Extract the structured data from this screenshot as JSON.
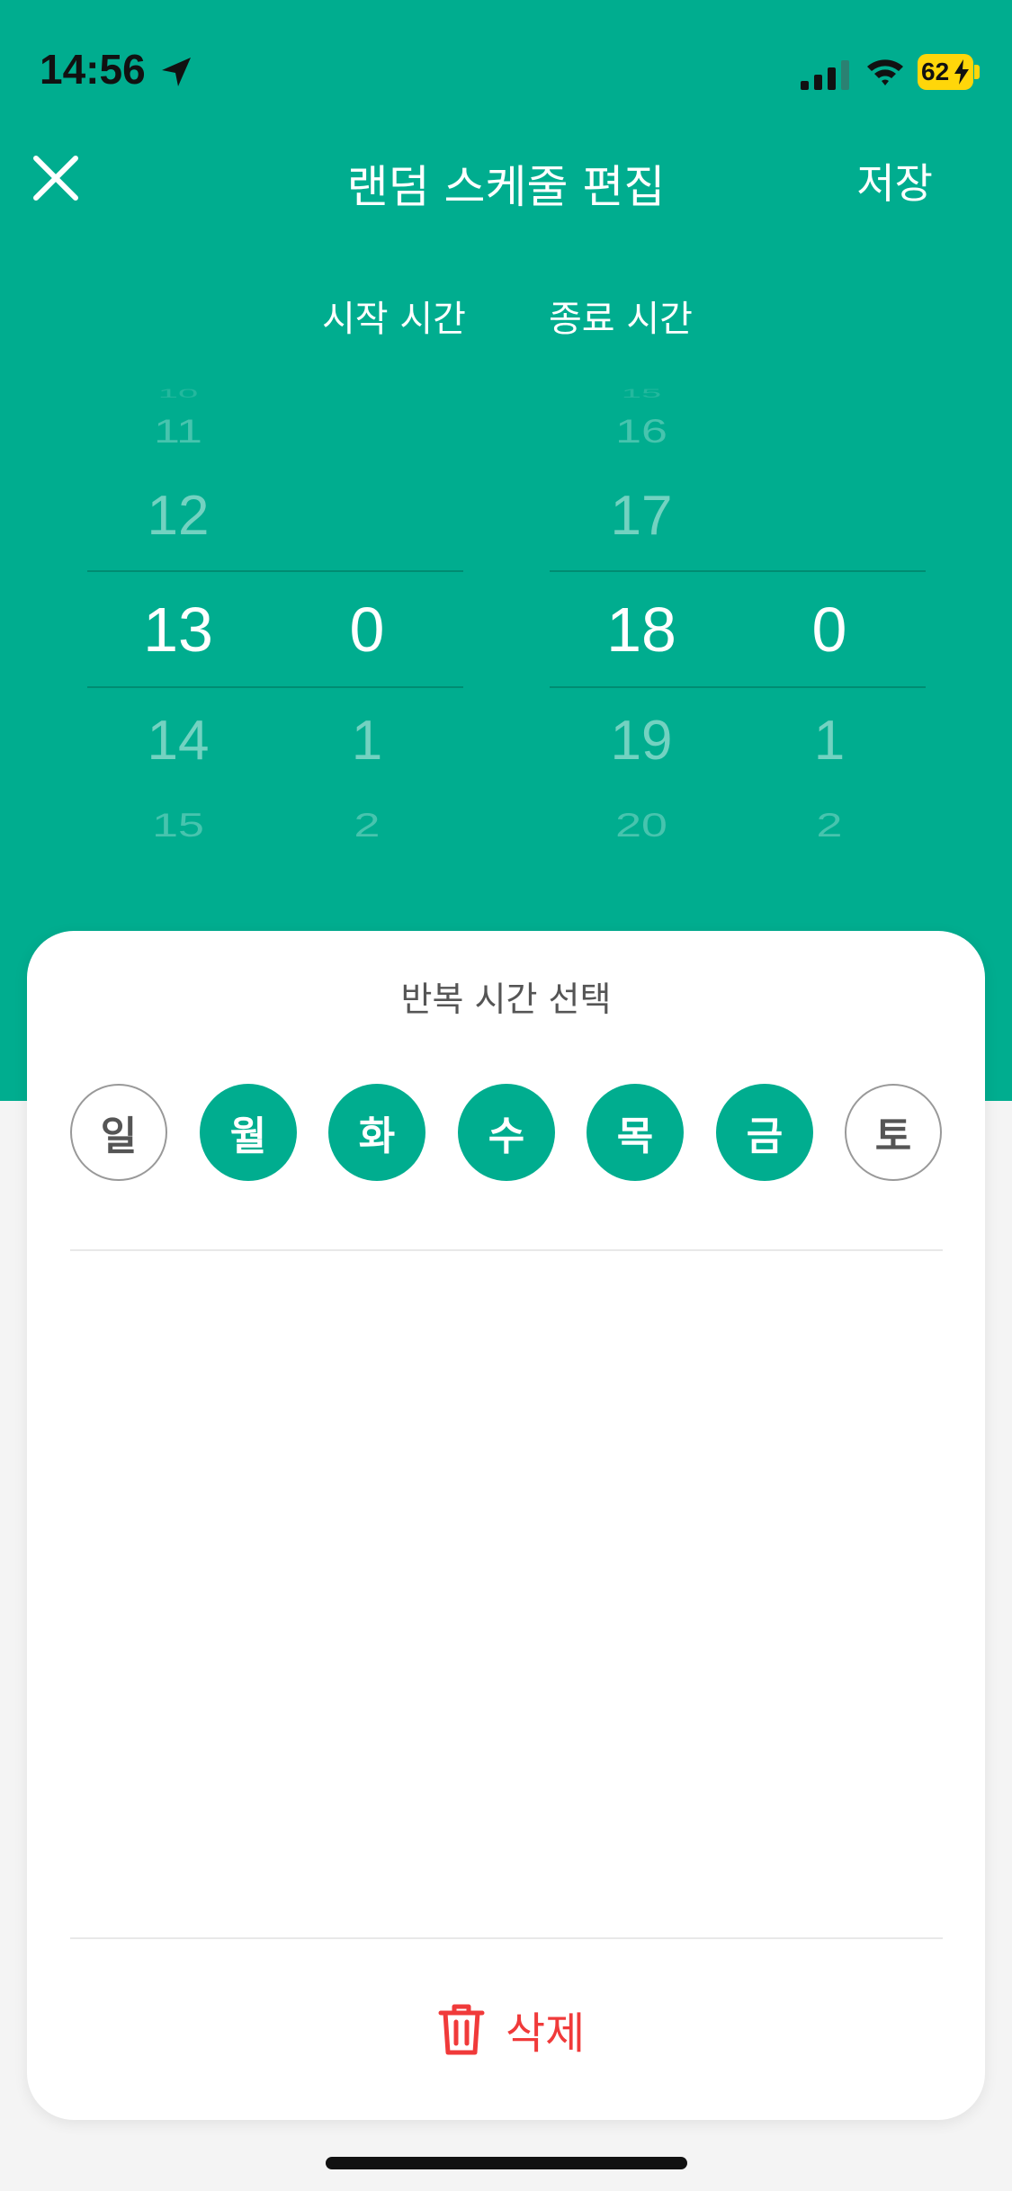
{
  "status_bar": {
    "time": "14:56",
    "battery": "62"
  },
  "nav": {
    "title": "랜덤 스케줄 편집",
    "save_label": "저장"
  },
  "columns": {
    "start": "시작 시간",
    "end": "종료 시간"
  },
  "start_picker": {
    "hours": [
      "10",
      "11",
      "12",
      "13",
      "14",
      "15"
    ],
    "minutes": [
      "0",
      "1",
      "2"
    ]
  },
  "end_picker": {
    "hours": [
      "15",
      "16",
      "17",
      "18",
      "19",
      "20"
    ],
    "minutes": [
      "0",
      "1",
      "2"
    ]
  },
  "repeat": {
    "title": "반복 시간 선택",
    "days": [
      {
        "label": "일",
        "selected": false
      },
      {
        "label": "월",
        "selected": true
      },
      {
        "label": "화",
        "selected": true
      },
      {
        "label": "수",
        "selected": true
      },
      {
        "label": "목",
        "selected": true
      },
      {
        "label": "금",
        "selected": true
      },
      {
        "label": "토",
        "selected": false
      }
    ]
  },
  "delete_label": "삭제",
  "colors": {
    "accent": "#00ad8f",
    "danger": "#f03a3a"
  }
}
